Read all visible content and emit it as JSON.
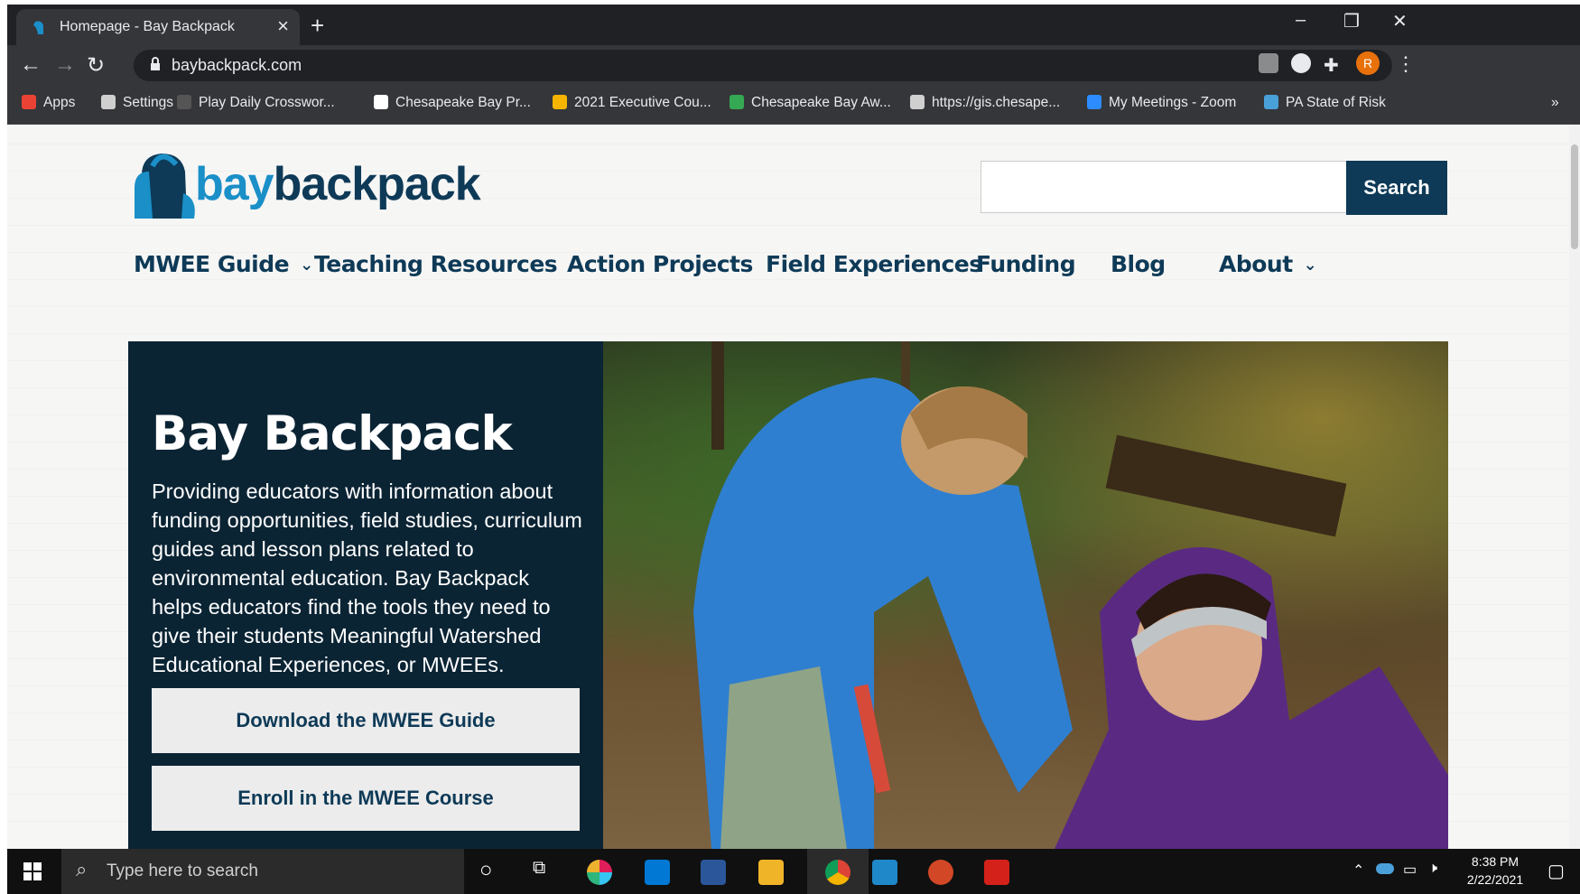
{
  "browser": {
    "tab_title": "Homepage - Bay Backpack",
    "tab_close": "×",
    "new_tab": "+",
    "url": "baybackpack.com",
    "bookmarks": [
      {
        "label": "Apps",
        "color": "#ea4335"
      },
      {
        "label": "Settings",
        "color": "#cfcfcf"
      },
      {
        "label": "Play Daily Crosswor...",
        "color": "#555555"
      },
      {
        "label": "Chesapeake Bay Pr...",
        "color": "#ffffff"
      },
      {
        "label": "2021 Executive Cou...",
        "color": "#f4b400"
      },
      {
        "label": "Chesapeake Bay Aw...",
        "color": "#34a853"
      },
      {
        "label": "https://gis.chesape...",
        "color": "#cfcfcf"
      },
      {
        "label": "My Meetings - Zoom",
        "color": "#2d8cff"
      },
      {
        "label": "PA State of Risk",
        "color": "#4aa0d8"
      }
    ],
    "bookmarks_more": "»",
    "profile_initial": "R",
    "profile_color": "#e8710a"
  },
  "site": {
    "logo_text_bay": "bay",
    "logo_text_backpack": "backpack",
    "logo_color_bay": "#1a8fc8",
    "logo_color_backpack": "#0e3a57",
    "search_button": "Search",
    "search_placeholder": "",
    "nav": [
      {
        "label": "MWEE Guide",
        "has_dropdown": true
      },
      {
        "label": "Teaching Resources",
        "has_dropdown": false
      },
      {
        "label": "Action Projects",
        "has_dropdown": false
      },
      {
        "label": "Field Experiences",
        "has_dropdown": false
      },
      {
        "label": "Funding",
        "has_dropdown": false
      },
      {
        "label": "Blog",
        "has_dropdown": false
      },
      {
        "label": "About",
        "has_dropdown": true
      }
    ],
    "nav_chevron": "⌄",
    "hero": {
      "title": "Bay Backpack",
      "description": "Providing educators with information about funding opportunities, field studies, curriculum guides and lesson plans related to environmental education. Bay Backpack helps educators find the tools they need to give their students Meaningful Watershed Educational Experiences, or MWEEs.",
      "buttons": [
        "Download the MWEE Guide",
        "Enroll in the MWEE Course"
      ]
    }
  },
  "taskbar": {
    "search_placeholder": "Type here to search",
    "time": "8:38 PM",
    "date": "2/22/2021"
  }
}
